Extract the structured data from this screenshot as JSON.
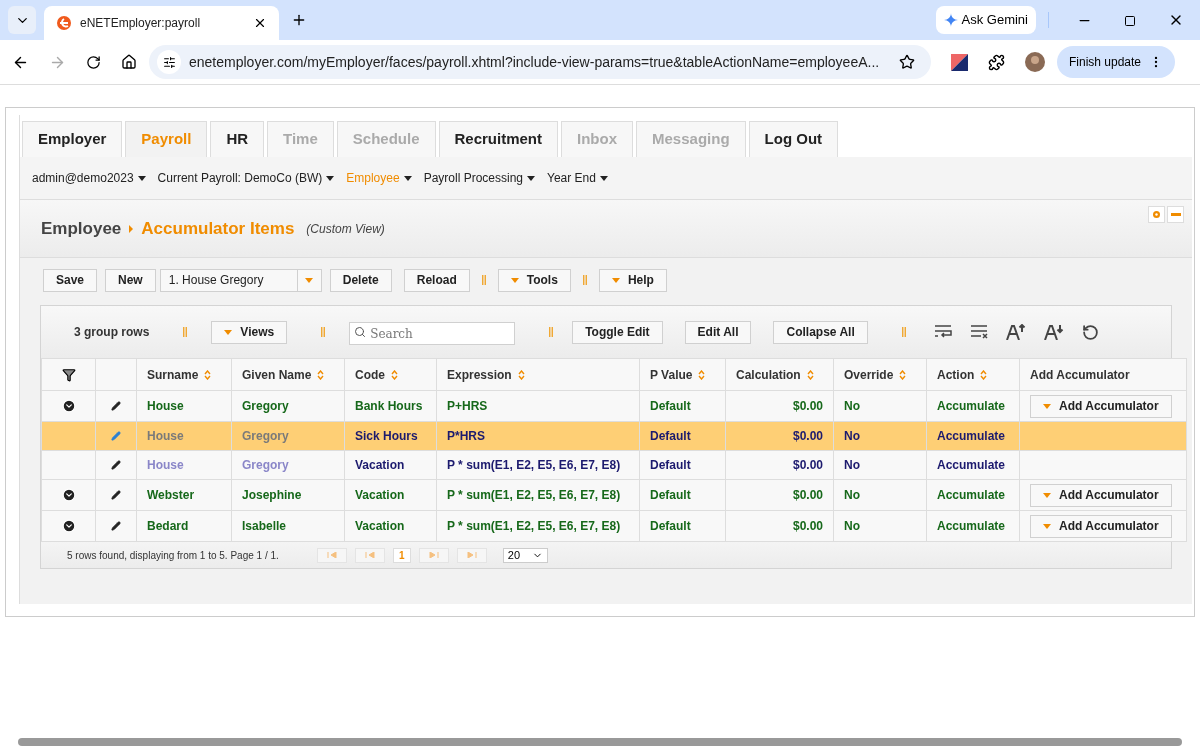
{
  "browser": {
    "tab_title": "eNETEmployer:payroll",
    "url": "enetemployer.com/myEmployer/faces/payroll.xhtml?include-view-params=true&tableActionName=employeeA...",
    "gemini": "Ask Gemini",
    "update": "Finish update"
  },
  "tabs": [
    {
      "label": "Employer",
      "selected": false,
      "disabled": false
    },
    {
      "label": "Payroll",
      "selected": true,
      "disabled": false
    },
    {
      "label": "HR",
      "selected": false,
      "disabled": false
    },
    {
      "label": "Time",
      "selected": false,
      "disabled": true
    },
    {
      "label": "Schedule",
      "selected": false,
      "disabled": true
    },
    {
      "label": "Recruitment",
      "selected": false,
      "disabled": false
    },
    {
      "label": "Inbox",
      "selected": false,
      "disabled": true
    },
    {
      "label": "Messaging",
      "selected": false,
      "disabled": true
    },
    {
      "label": "Log Out",
      "selected": false,
      "disabled": false
    }
  ],
  "menu": [
    {
      "label": "admin@demo2023",
      "selected": false
    },
    {
      "label": "Current Payroll: DemoCo (BW)",
      "selected": false
    },
    {
      "label": "Employee",
      "selected": true
    },
    {
      "label": "Payroll Processing",
      "selected": false
    },
    {
      "label": "Year End",
      "selected": false
    }
  ],
  "breadcrumb": {
    "parent": "Employee",
    "current": "Accumulator Items",
    "note": "(Custom View)"
  },
  "toolbar": {
    "save": "Save",
    "new": "New",
    "record": "1. House Gregory",
    "delete": "Delete",
    "reload": "Reload",
    "tools": "Tools",
    "help": "Help"
  },
  "table_toolbar": {
    "group_count": "3 group rows",
    "views": "Views",
    "search_placeholder": "Search",
    "toggle_edit": "Toggle Edit",
    "edit_all": "Edit All",
    "collapse_all": "Collapse All"
  },
  "table": {
    "columns": [
      "Surname",
      "Given Name",
      "Code",
      "Expression",
      "P Value",
      "Calculation",
      "Override",
      "Action",
      "Add Accumulator"
    ],
    "rows": [
      {
        "kind": "group",
        "selected": false,
        "surname": "House",
        "given_name": "Gregory",
        "code": "Bank Hours",
        "expression": "P+HRS",
        "p_value": "Default",
        "calculation": "$0.00",
        "override": "No",
        "action": "Accumulate",
        "add_button": "Add Accumulator"
      },
      {
        "kind": "detail",
        "selected": true,
        "surname": "House",
        "given_name": "Gregory",
        "code": "Sick Hours",
        "expression": "P*HRS",
        "p_value": "Default",
        "calculation": "$0.00",
        "override": "No",
        "action": "Accumulate"
      },
      {
        "kind": "detail",
        "selected": false,
        "surname": "House",
        "given_name": "Gregory",
        "code": "Vacation",
        "expression": "P * sum(E1, E2, E5, E6, E7, E8)",
        "p_value": "Default",
        "calculation": "$0.00",
        "override": "No",
        "action": "Accumulate"
      },
      {
        "kind": "group",
        "selected": false,
        "surname": "Webster",
        "given_name": "Josephine",
        "code": "Vacation",
        "expression": "P * sum(E1, E2, E5, E6, E7, E8)",
        "p_value": "Default",
        "calculation": "$0.00",
        "override": "No",
        "action": "Accumulate",
        "add_button": "Add Accumulator"
      },
      {
        "kind": "group",
        "selected": false,
        "surname": "Bedard",
        "given_name": "Isabelle",
        "code": "Vacation",
        "expression": "P * sum(E1, E2, E5, E6, E7, E8)",
        "p_value": "Default",
        "calculation": "$0.00",
        "override": "No",
        "action": "Accumulate",
        "add_button": "Add Accumulator"
      }
    ]
  },
  "footer": {
    "summary": "5 rows found, displaying from 1 to 5. Page 1 / 1.",
    "page": "1",
    "page_size": "20"
  }
}
